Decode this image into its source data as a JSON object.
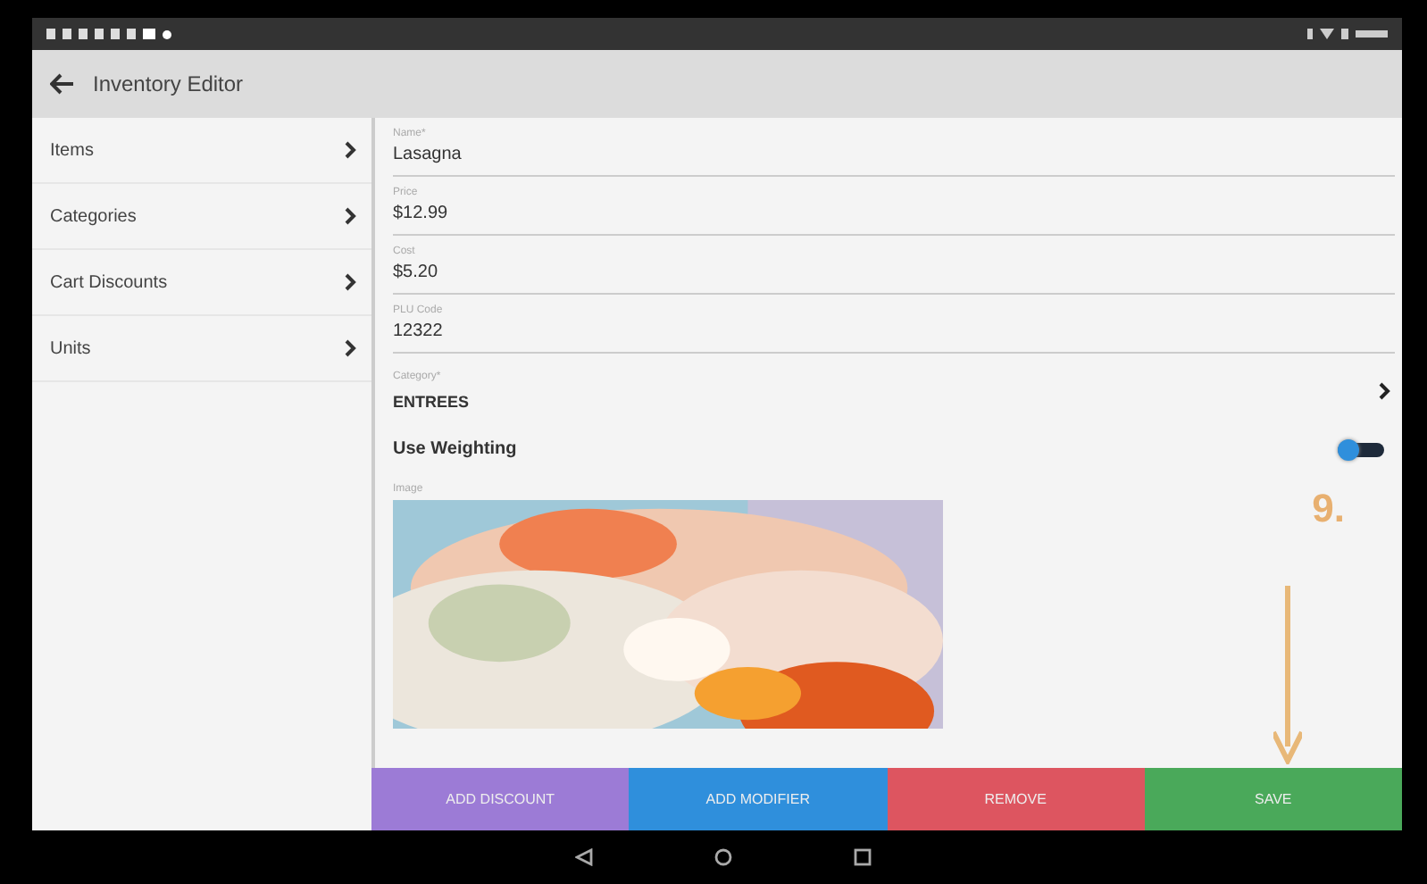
{
  "app_bar": {
    "title": "Inventory Editor"
  },
  "sidebar": {
    "items": [
      {
        "label": "Items"
      },
      {
        "label": "Categories"
      },
      {
        "label": "Cart Discounts"
      },
      {
        "label": "Units"
      }
    ]
  },
  "form": {
    "fields": [
      {
        "label": "Name*",
        "value": "Lasagna"
      },
      {
        "label": "Price",
        "value": "$12.99"
      },
      {
        "label": "Cost",
        "value": "$5.20"
      },
      {
        "label": "PLU Code",
        "value": "12322"
      }
    ],
    "category": {
      "label": "Category*",
      "value": "ENTREES"
    },
    "weighting": {
      "label": "Use Weighting",
      "on": true
    },
    "image": {
      "label": "Image",
      "kind": "picture"
    }
  },
  "actions": [
    {
      "label": "ADD DISCOUNT",
      "color": "#9c7bd6"
    },
    {
      "label": "ADD MODIFIER",
      "color": "#2f8fdc"
    },
    {
      "label": "REMOVE",
      "color": "#dd5560"
    },
    {
      "label": "SAVE",
      "color": "#4aa95a"
    }
  ],
  "annotation": {
    "step": "9."
  }
}
